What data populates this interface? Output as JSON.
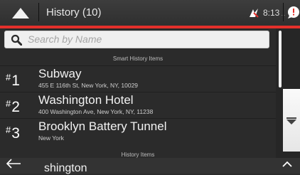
{
  "header": {
    "title": "History (10)",
    "time": "8:13",
    "time_suffix": "...",
    "icons": [
      "up-arrow-icon",
      "gps-signal-icon",
      "notification-icon"
    ]
  },
  "search": {
    "placeholder": "Search by Name",
    "icon": "search-icon"
  },
  "sections": {
    "smart_history": "Smart History Items",
    "history": "History Items"
  },
  "items": [
    {
      "index": "1",
      "name": "Subway",
      "address": "455 E 116th St, New York, NY, 10029"
    },
    {
      "index": "2",
      "name": "Washington Hotel",
      "address": "400 Washington Ave, New York, NY, 11238"
    },
    {
      "index": "3",
      "name": "Brooklyn Battery Tunnel",
      "address": "New York"
    }
  ],
  "partial_item": {
    "name": "shington"
  },
  "colors": {
    "accent": "#e4302b",
    "background": "#2b2b2b",
    "search_bg": "#efefef",
    "text": "#ffffff"
  }
}
